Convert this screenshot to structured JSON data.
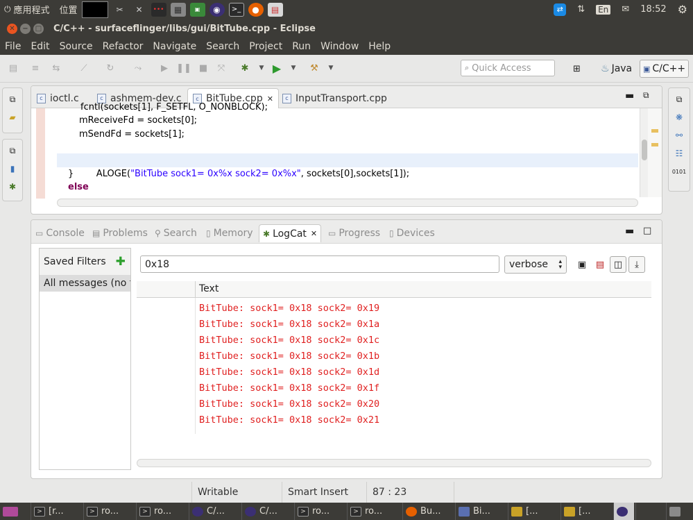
{
  "top_panel": {
    "apps_label": "應用程式",
    "places_label": "位置",
    "language": "En",
    "time": "18:52"
  },
  "window": {
    "title": "C/C++ - surfaceflinger/libs/gui/BitTube.cpp - Eclipse"
  },
  "menu": [
    "File",
    "Edit",
    "Source",
    "Refactor",
    "Navigate",
    "Search",
    "Project",
    "Run",
    "Window",
    "Help"
  ],
  "toolbar": {
    "quick_access_placeholder": "Quick Access",
    "perspective_java": "Java",
    "perspective_cpp": "C/C++"
  },
  "editor": {
    "tabs": [
      {
        "label": "ioctl.c"
      },
      {
        "label": "ashmem-dev.c"
      },
      {
        "label": "BitTube.cpp",
        "close": "✕"
      },
      {
        "label": "InputTransport.cpp"
      }
    ],
    "lines": {
      "l0": "fcntl(sockets[1], F_SETFL, O_NONBLOCK);",
      "l1": "mReceiveFd = sockets[0];",
      "l2": "mSendFd = sockets[1];",
      "l4_prefix": "ALOGE(",
      "l4_string": "\"BitTube sock1= 0x%x sock2= 0x%x\"",
      "l4_suffix": ", sockets[0],sockets[1]);",
      "l5": "}",
      "l6": "else"
    }
  },
  "views": {
    "tabs": [
      {
        "label": "Console"
      },
      {
        "label": "Problems"
      },
      {
        "label": "Search"
      },
      {
        "label": "Memory"
      },
      {
        "label": "LogCat",
        "close": "✕"
      },
      {
        "label": "Progress"
      },
      {
        "label": "Devices"
      }
    ],
    "saved_filters_label": "Saved Filters",
    "all_messages_label": "All messages (no fi",
    "search_value": "0x18",
    "level_value": "verbose",
    "column_header": "Text",
    "log_rows": [
      "BitTube: sock1= 0x18 sock2= 0x19",
      "BitTube: sock1= 0x18 sock2= 0x1a",
      "BitTube: sock1= 0x18 sock2= 0x1c",
      "BitTube: sock1= 0x18 sock2= 0x1b",
      "BitTube: sock1= 0x18 sock2= 0x1d",
      "BitTube: sock1= 0x18 sock2= 0x1f",
      "BitTube: sock1= 0x18 sock2= 0x20",
      "BitTube: sock1= 0x18 sock2= 0x21"
    ]
  },
  "status": {
    "writable": "Writable",
    "insert_mode": "Smart Insert",
    "position": "87 : 23"
  },
  "taskbar": [
    {
      "label": "[r..."
    },
    {
      "label": "ro..."
    },
    {
      "label": "ro..."
    },
    {
      "label": "C/..."
    },
    {
      "label": "C/..."
    },
    {
      "label": "ro..."
    },
    {
      "label": "ro..."
    },
    {
      "label": "Bu..."
    },
    {
      "label": "Bi..."
    },
    {
      "label": "[..."
    },
    {
      "label": "[..."
    }
  ]
}
